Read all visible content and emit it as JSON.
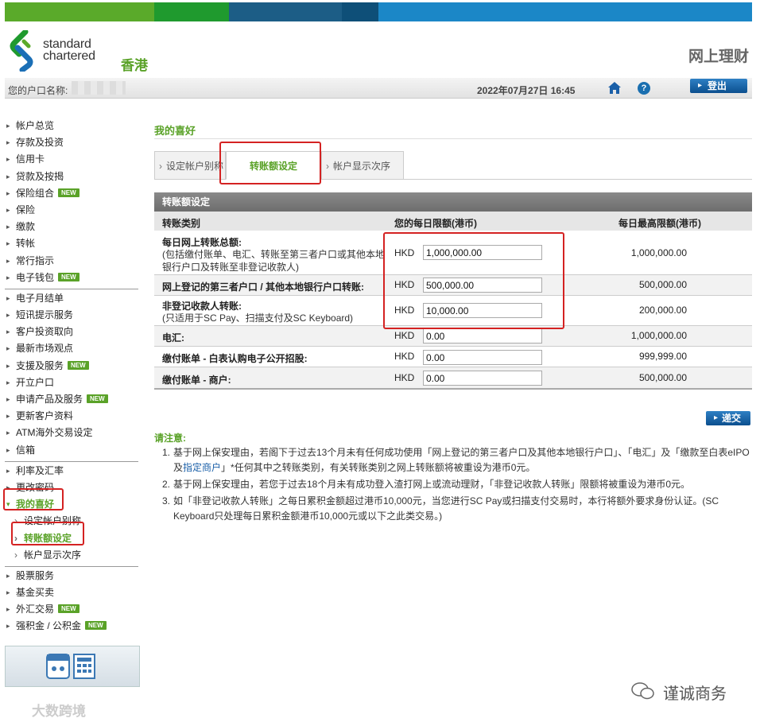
{
  "colors": {
    "bar": [
      "#5aaa2a",
      "#1f9a2e",
      "#1c5d86",
      "#0e4f78",
      "#1b87c7",
      "#0a5c9a"
    ],
    "accent": "#5aa228",
    "highlight": "#d42222"
  },
  "header": {
    "brand_line1": "standard",
    "brand_line2": "chartered",
    "region": "香港",
    "site_title": "网上理财"
  },
  "account_bar": {
    "label": "您的户口名称:",
    "datetime": "2022年07月27日 16:45",
    "logout": "登出"
  },
  "sidebar": {
    "group1": [
      {
        "label": "帐户总览"
      },
      {
        "label": "存款及投资"
      },
      {
        "label": "信用卡"
      },
      {
        "label": "贷款及按揭"
      },
      {
        "label": "保险组合",
        "badge": "NEW"
      },
      {
        "label": "保险"
      },
      {
        "label": "缴款"
      },
      {
        "label": "转帐"
      },
      {
        "label": "常行指示"
      },
      {
        "label": "电子钱包",
        "badge": "NEW"
      }
    ],
    "group2": [
      {
        "label": "电子月结单"
      },
      {
        "label": "短讯提示服务"
      },
      {
        "label": "客户投资取向"
      },
      {
        "label": "最新市场观点"
      },
      {
        "label": "支援及服务",
        "badge": "NEW"
      },
      {
        "label": "开立户口"
      },
      {
        "label": "申请产品及服务",
        "badge": "NEW"
      },
      {
        "label": "更新客户资料"
      },
      {
        "label": "ATM海外交易设定"
      },
      {
        "label": "信箱"
      }
    ],
    "group3": [
      {
        "label": "利率及汇率"
      },
      {
        "label": "更改密码"
      }
    ],
    "favorites": "我的喜好",
    "favorites_sub": [
      "设定帐户别称",
      "转账额设定",
      "帐户显示次序"
    ],
    "group4": [
      {
        "label": "股票服务"
      },
      {
        "label": "基金买卖"
      },
      {
        "label": "外汇交易",
        "badge": "NEW"
      },
      {
        "label": "强积金 / 公积金",
        "badge": "NEW"
      }
    ]
  },
  "main": {
    "title": "我的喜好",
    "tabs": [
      "设定帐户别称",
      "转账额设定",
      "帐户显示次序"
    ],
    "panel_title": "转账额设定",
    "columns": [
      "转账类别",
      "您的每日限额(港币)",
      "每日最高限额(港币)"
    ],
    "rows": [
      {
        "label": "每日网上转账总额:",
        "note": "(包括缴付账单、电汇、转账至第三者户口或其他本地银行户口及转账至非登记收款人)",
        "currency": "HKD",
        "value": "1,000,000.00",
        "max": "1,000,000.00"
      },
      {
        "label": "网上登记的第三者户口 / 其他本地银行户口转账:",
        "note": "",
        "currency": "HKD",
        "value": "500,000.00",
        "max": "500,000.00"
      },
      {
        "label": "非登记收款人转账:",
        "note": "(只适用于SC Pay、扫描支付及SC Keyboard)",
        "currency": "HKD",
        "value": "10,000.00",
        "max": "200,000.00"
      },
      {
        "label": "电汇:",
        "note": "",
        "currency": "HKD",
        "value": "0.00",
        "max": "1,000,000.00"
      },
      {
        "label": "缴付账单 - 白表认购电子公开招股:",
        "note": "",
        "currency": "HKD",
        "value": "0.00",
        "max": "999,999.00"
      },
      {
        "label": "缴付账单 - 商户:",
        "note": "",
        "currency": "HKD",
        "value": "0.00",
        "max": "500,000.00"
      }
    ],
    "submit": "递交",
    "notes_title": "请注意:",
    "notes": [
      {
        "num": "1.",
        "pre": "基于网上保安理由，若阁下于过去13个月未有任何成功使用「网上登记的第三者户口及其他本地银行户口」、「电汇」及「缴款至白表eIPO及",
        "link": "指定商户",
        "post": "」*任何其中之转账类别，有关转账类别之网上转账额将被重设为港币0元。"
      },
      {
        "num": "2.",
        "pre": "基于网上保安理由，若您于过去18个月未有成功登入渣打网上或流动理财，「非登记收款人转账」限额将被重设为港币0元。",
        "link": "",
        "post": ""
      },
      {
        "num": "3.",
        "pre": "如「非登记收款人转账」之每日累积金额超过港币10,000元，当您进行SC Pay或扫描支付交易时，本行将额外要求身份认证。(SC Keyboard只处理每日累积金额港币10,000元或以下之此类交易。)",
        "link": "",
        "post": ""
      }
    ]
  },
  "watermarks": {
    "right": "谨诚商务",
    "left": "大数跨境"
  }
}
